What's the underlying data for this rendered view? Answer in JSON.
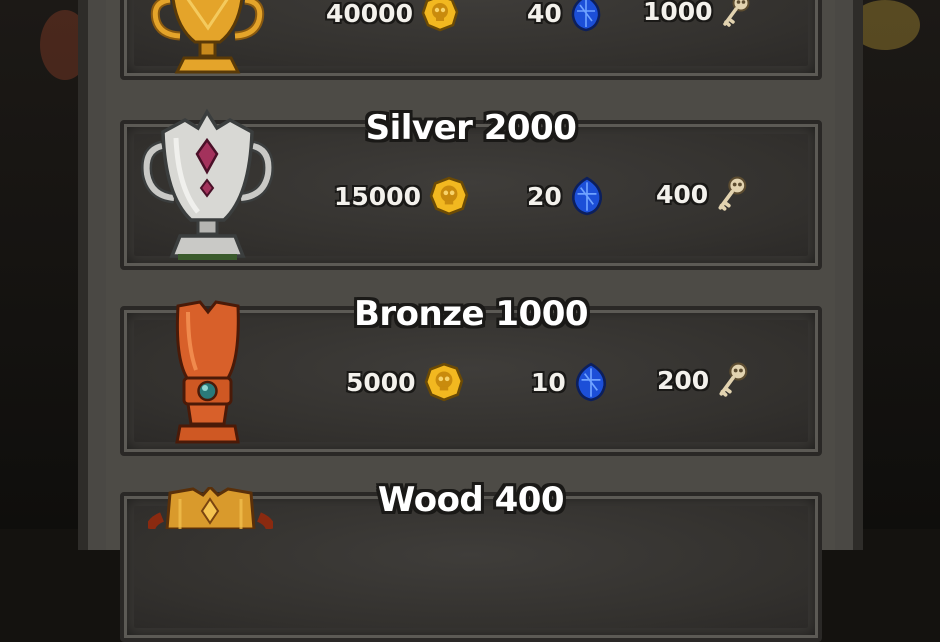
{
  "tiers": [
    {
      "id": "gold",
      "title": "",
      "coins": "40000",
      "gems": "40",
      "keys": "1000",
      "trophy_icon": "gold-trophy-icon",
      "colors": {
        "main": "#e4a42a",
        "light": "#f7d36a",
        "dark": "#8a5a10"
      }
    },
    {
      "id": "silver",
      "title": "Silver 2000",
      "coins": "15000",
      "gems": "20",
      "keys": "400",
      "trophy_icon": "silver-trophy-icon",
      "colors": {
        "main": "#c9c9c6",
        "light": "#eeeeea",
        "dark": "#5d6060"
      }
    },
    {
      "id": "bronze",
      "title": "Bronze 1000",
      "coins": "5000",
      "gems": "10",
      "keys": "200",
      "trophy_icon": "bronze-trophy-icon",
      "colors": {
        "main": "#d8602a",
        "light": "#f08a4d",
        "dark": "#7c2c10"
      }
    },
    {
      "id": "wood",
      "title": "Wood 400",
      "trophy_icon": "wood-trophy-icon",
      "colors": {
        "main": "#d99a2c",
        "light": "#f5c451",
        "dark": "#7a4410"
      }
    }
  ],
  "icons": {
    "coin": "skull-coin-icon",
    "gem": "blue-gem-icon",
    "key": "skull-key-icon"
  },
  "palette": {
    "coin_gold": "#f2b820",
    "gem_blue": "#1c4fd8",
    "key_bone": "#e2d3b0",
    "text": "#ffffff",
    "outline": "#1a1917"
  }
}
